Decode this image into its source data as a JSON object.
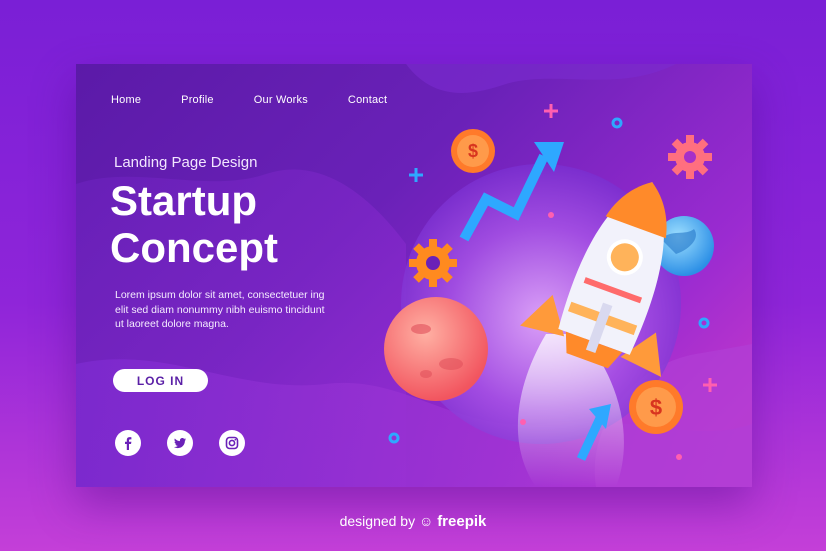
{
  "nav": {
    "items": [
      "Home",
      "Profile",
      "Our Works",
      "Contact"
    ]
  },
  "hero": {
    "subtitle": "Landing Page Design",
    "title_line1": "Startup",
    "title_line2": "Concept",
    "description": "Lorem ipsum dolor sit amet, consectetuer ing elit sed diam nonummy nibh euismo tincidunt ut laoreet dolore magna.",
    "login_label": "LOG IN"
  },
  "social": {
    "icons": [
      "facebook-icon",
      "twitter-icon",
      "instagram-icon"
    ]
  },
  "coins": {
    "symbol": "$"
  },
  "footer": {
    "prefix": "designed by",
    "brand": "freepik"
  },
  "colors": {
    "bg_top": "#7a1fd6",
    "card_dark": "#5b1aa8",
    "card_pink": "#d23cc8",
    "coin": "#ff7a2a",
    "arrow": "#2ea8ff",
    "gear": "#ff8a1f",
    "planet_red": "#ff6b6b",
    "planet_blue": "#4fb7ff"
  }
}
